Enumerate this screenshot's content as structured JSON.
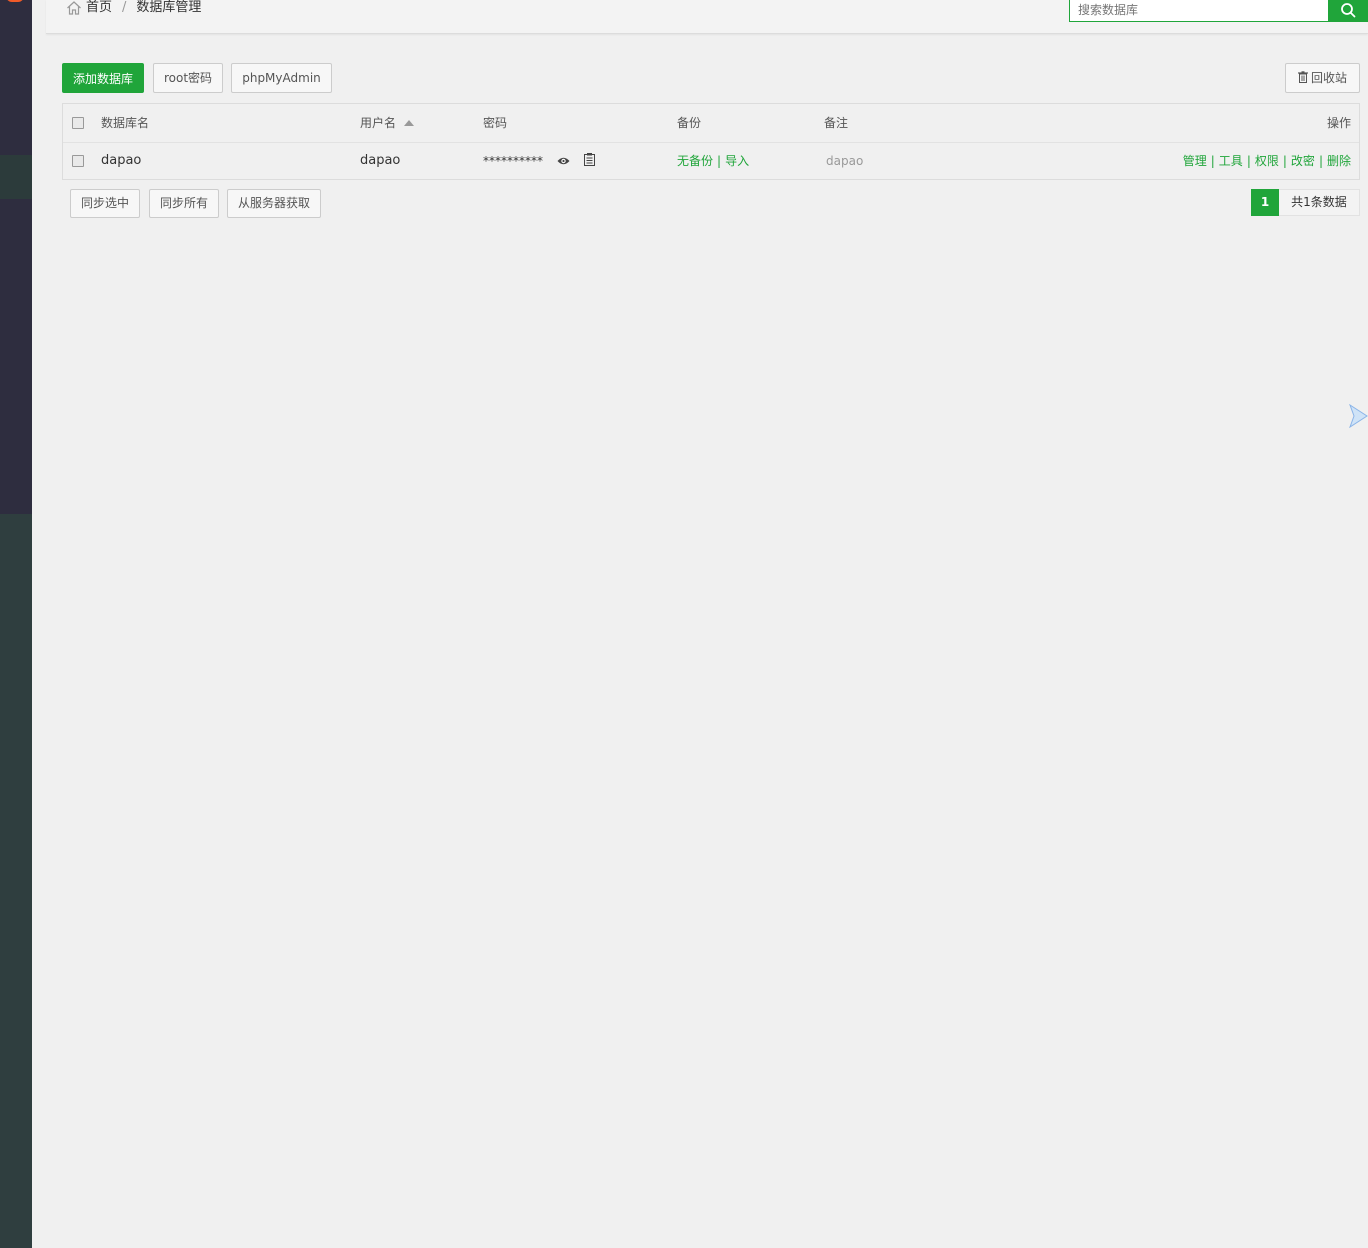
{
  "breadcrumb": {
    "home": "首页",
    "separator": "/",
    "current": "数据库管理"
  },
  "search": {
    "placeholder": "搜索数据库"
  },
  "toolbar": {
    "add_db": "添加数据库",
    "root_password": "root密码",
    "phpmyadmin": "phpMyAdmin",
    "recycle_bin": "回收站"
  },
  "table": {
    "headers": {
      "db_name": "数据库名",
      "username": "用户名",
      "password": "密码",
      "backup": "备份",
      "note": "备注",
      "actions": "操作"
    },
    "rows": [
      {
        "db_name": "dapao",
        "username": "dapao",
        "password": "**********",
        "backup_status": "无备份",
        "import": "导入",
        "note": "dapao",
        "actions": [
          "管理",
          "工具",
          "权限",
          "改密",
          "删除"
        ]
      }
    ]
  },
  "bottom_buttons": {
    "sync_selected": "同步选中",
    "sync_all": "同步所有",
    "fetch_server": "从服务器获取"
  },
  "pagination": {
    "current_page": "1",
    "total": "共1条数据"
  },
  "colors": {
    "accent": "#20a53a",
    "sidebar": "#2e2d3f",
    "sidebar_bottom": "#2f3e3f"
  }
}
